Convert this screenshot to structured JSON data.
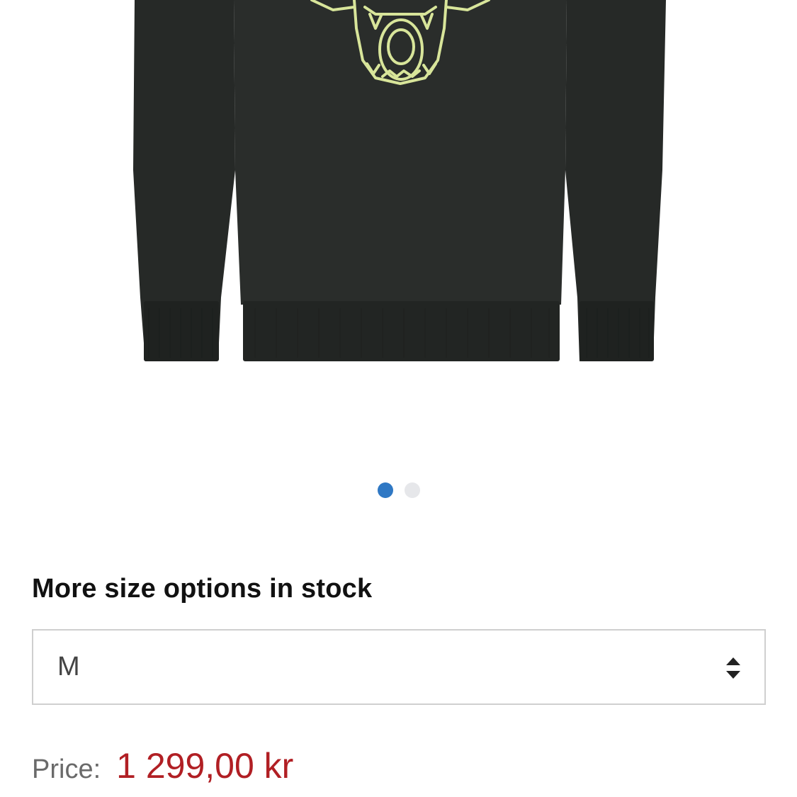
{
  "product": {
    "image_alt": "Black crewneck sweatshirt with yellow outlined wolf graphic"
  },
  "carousel": {
    "dots": [
      {
        "state": "active"
      },
      {
        "state": "inactive"
      }
    ],
    "active_color": "#2f78c4",
    "inactive_color": "#e6e7ea"
  },
  "size": {
    "heading": "More size options in stock",
    "selected": "M"
  },
  "price": {
    "label": "Price:",
    "value": "1 299,00 kr",
    "color": "#b11f24"
  },
  "icons": {
    "select_arrows": "sort-up-down-icon"
  }
}
